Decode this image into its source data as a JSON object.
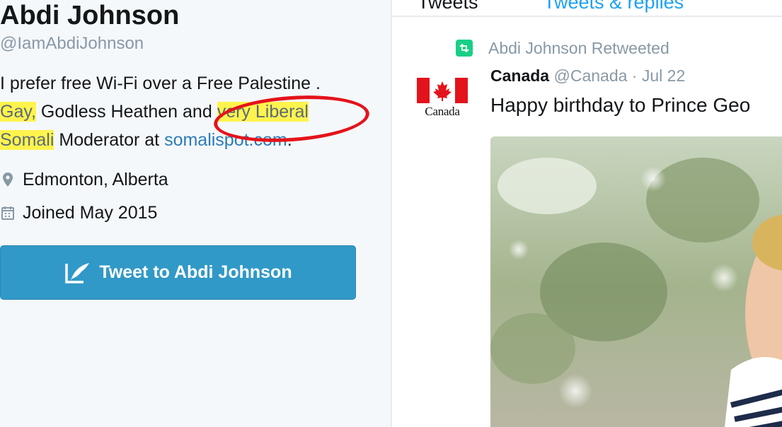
{
  "profile": {
    "name": "Abdi Johnson",
    "handle": "@IamAbdiJohnson",
    "bio": {
      "part1": "I prefer free Wi-Fi over a Free Palestine . ",
      "hl1": "Gay,",
      "part2": " Godless Heathen and ",
      "hl2": "very Liberal",
      "hl3": "Somali",
      "part3": " Moderator at ",
      "link": "somalispot.com",
      "part4": "."
    },
    "location": "Edmonton, Alberta",
    "location_icon": "map-pin-icon",
    "joined": "Joined May 2015",
    "joined_icon": "calendar-icon",
    "tweet_to_label": "Tweet to Abdi Johnson",
    "tweet_to_icon": "compose-quill-icon"
  },
  "tabs": [
    {
      "label": "Tweets"
    },
    {
      "label": "Tweets & replies"
    }
  ],
  "tweet": {
    "retweet_text": "Abdi Johnson Retweeted",
    "author_name": "Canada",
    "author_handle": "@Canada",
    "separator": "·",
    "date": "Jul 22",
    "text": "Happy birthday to Prince Geo",
    "avatar_wordmark": "Canada"
  },
  "colors": {
    "highlight": "#fff34d",
    "annotation_circle": "#e4131b",
    "button": "#3199c7",
    "link": "#2b7bb9",
    "retweet": "#19cf86",
    "flag_red": "#e4131b"
  }
}
